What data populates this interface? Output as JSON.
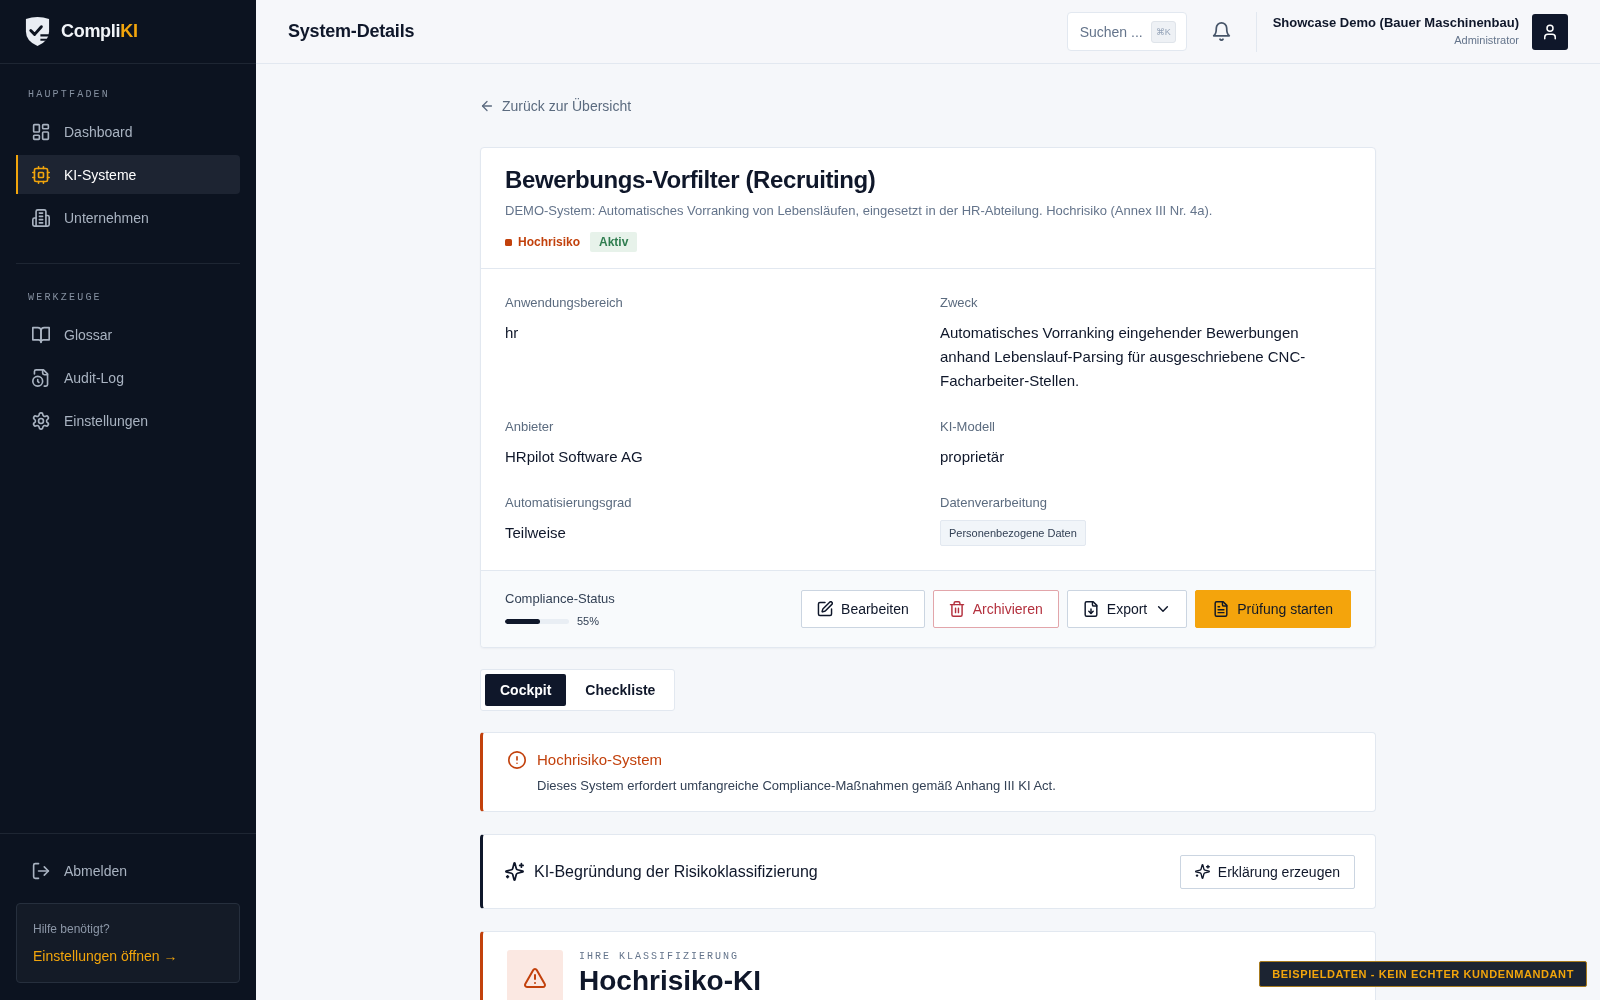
{
  "sidebar": {
    "brand": "Compli**KI**",
    "sections": [
      {
        "heading": "HAUPTFADEN",
        "items": [
          {
            "label": "Dashboard",
            "selected": false
          },
          {
            "label": "KI-Systeme",
            "selected": true
          },
          {
            "label": "Unternehmen",
            "selected": false
          }
        ]
      },
      {
        "heading": "WERKZEUGE",
        "items": [
          {
            "label": "Glossar",
            "selected": false
          },
          {
            "label": "Audit-Log",
            "selected": false
          },
          {
            "label": "Einstellungen",
            "selected": false
          }
        ]
      }
    ],
    "logout": "Abmelden",
    "help": {
      "question": "Hilfe benötigt?",
      "link": "Einstellungen öffnen →"
    }
  },
  "header": {
    "title": "System-Details",
    "search": {
      "placeholder": "Suchen ...",
      "shortcut": "⌘K"
    },
    "user": {
      "name": "Showcase Demo (Bauer Maschinenbau)",
      "role": "Administrator"
    }
  },
  "back_link": "Zurück zur Übersicht",
  "system": {
    "title": "Bewerbungs-Vorfilter (Recruiting)",
    "description": "DEMO-System: Automatisches Vorranking von Lebensläufen, eingesetzt in der HR-Abteilung. Hochrisiko (Annex III Nr. 4a).",
    "risk_badge": {
      "label": "Hochrisiko",
      "color": "#c2410c"
    },
    "status_badge": "Aktiv",
    "fields": [
      {
        "label": "Anwendungsbereich",
        "kind": "text",
        "value": "hr"
      },
      {
        "label": "Zweck",
        "kind": "text",
        "value": "Automatisches Vorranking eingehender Bewerbungen anhand Lebenslauf-Parsing für ausgeschriebene CNC-Facharbeiter-Stellen."
      },
      {
        "label": "Anbieter",
        "kind": "text",
        "value": "HRpilot Software AG"
      },
      {
        "label": "KI-Modell",
        "kind": "text",
        "value": "proprietär"
      },
      {
        "label": "Automatisierungsgrad",
        "kind": "text",
        "value": "Teilweise"
      },
      {
        "label": "Datenverarbeitung",
        "kind": "tags",
        "tags": [
          "Personenbezogene Daten"
        ]
      }
    ],
    "compliance": {
      "label": "Compliance-Status",
      "level": 0.55,
      "reading": "55%"
    },
    "actions": [
      {
        "label": "Bearbeiten",
        "kind": "edit"
      },
      {
        "label": "Archivieren",
        "kind": "archive"
      },
      {
        "label": "Export",
        "kind": "export"
      },
      {
        "label": "Prüfung starten",
        "kind": "start"
      }
    ]
  },
  "tabs": [
    {
      "label": "Cockpit",
      "selected": true
    },
    {
      "label": "Checkliste",
      "selected": false
    }
  ],
  "alert": {
    "title": "Hochrisiko-System",
    "text": "Dieses System erfordert umfangreiche Compliance-Maßnahmen gemäß Anhang III KI Act."
  },
  "explanation": {
    "title": "KI-Begründung der Risikoklassifizierung",
    "button": "Erklärung erzeugen"
  },
  "classification": {
    "eyebrow": "IHRE KLASSIFIZIERUNG",
    "title": "Hochrisiko-KI"
  },
  "banner": "BEISPIELDATEN - KEIN ECHTER KUNDENMANDANT"
}
